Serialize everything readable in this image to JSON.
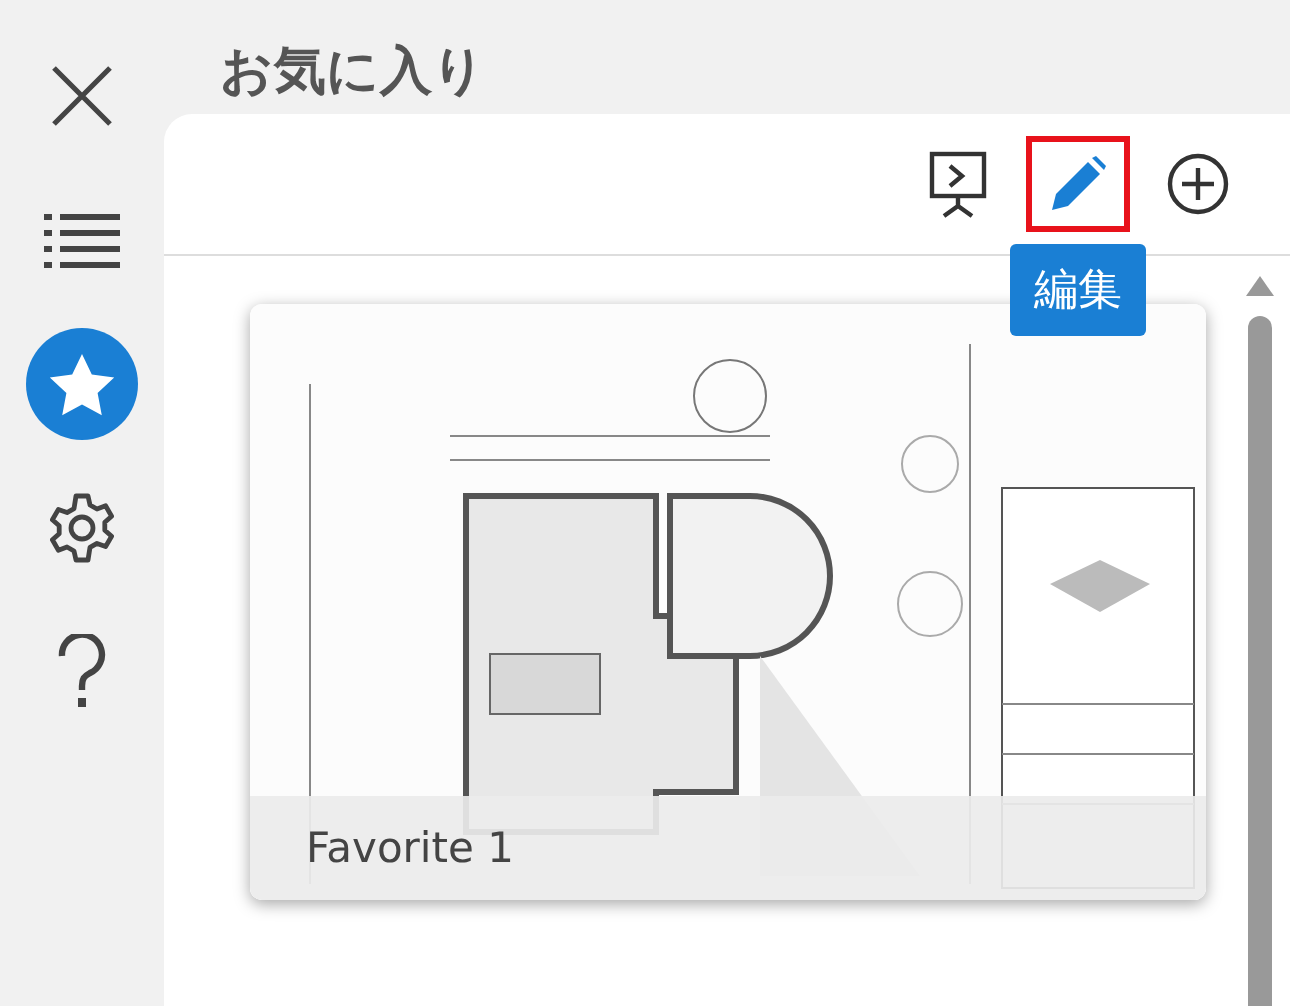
{
  "sidebar": {
    "items": [
      {
        "kind": "close",
        "selected": false
      },
      {
        "kind": "list",
        "selected": false
      },
      {
        "kind": "star",
        "selected": true
      },
      {
        "kind": "settings",
        "selected": false
      },
      {
        "kind": "help",
        "selected": false
      }
    ]
  },
  "title": "お気に入り",
  "toolbar": {
    "buttons": [
      {
        "kind": "present",
        "highlighted": false
      },
      {
        "kind": "edit",
        "highlighted": true
      },
      {
        "kind": "add",
        "highlighted": false
      }
    ]
  },
  "tooltip": "編集",
  "favorites": [
    {
      "caption": "Favorite 1",
      "kind": "picture"
    }
  ]
}
